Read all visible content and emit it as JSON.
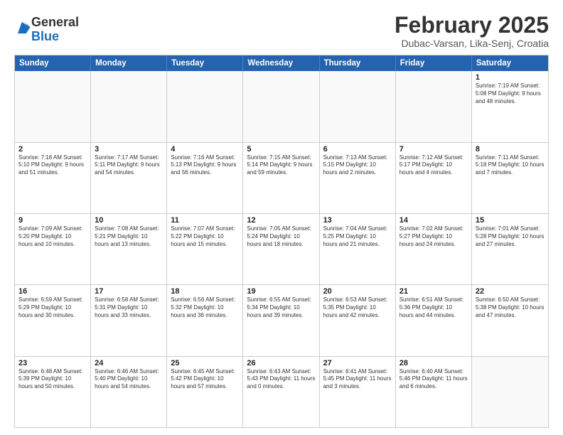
{
  "logo": {
    "general": "General",
    "blue": "Blue"
  },
  "title": "February 2025",
  "location": "Dubac-Varsan, Lika-Senj, Croatia",
  "header_days": [
    "Sunday",
    "Monday",
    "Tuesday",
    "Wednesday",
    "Thursday",
    "Friday",
    "Saturday"
  ],
  "rows": [
    [
      {
        "day": "",
        "text": ""
      },
      {
        "day": "",
        "text": ""
      },
      {
        "day": "",
        "text": ""
      },
      {
        "day": "",
        "text": ""
      },
      {
        "day": "",
        "text": ""
      },
      {
        "day": "",
        "text": ""
      },
      {
        "day": "1",
        "text": "Sunrise: 7:19 AM\nSunset: 5:08 PM\nDaylight: 9 hours\nand 48 minutes."
      }
    ],
    [
      {
        "day": "2",
        "text": "Sunrise: 7:18 AM\nSunset: 5:10 PM\nDaylight: 9 hours\nand 51 minutes."
      },
      {
        "day": "3",
        "text": "Sunrise: 7:17 AM\nSunset: 5:11 PM\nDaylight: 9 hours\nand 54 minutes."
      },
      {
        "day": "4",
        "text": "Sunrise: 7:16 AM\nSunset: 5:13 PM\nDaylight: 9 hours\nand 56 minutes."
      },
      {
        "day": "5",
        "text": "Sunrise: 7:15 AM\nSunset: 5:14 PM\nDaylight: 9 hours\nand 59 minutes."
      },
      {
        "day": "6",
        "text": "Sunrise: 7:13 AM\nSunset: 5:15 PM\nDaylight: 10 hours\nand 2 minutes."
      },
      {
        "day": "7",
        "text": "Sunrise: 7:12 AM\nSunset: 5:17 PM\nDaylight: 10 hours\nand 4 minutes."
      },
      {
        "day": "8",
        "text": "Sunrise: 7:11 AM\nSunset: 5:18 PM\nDaylight: 10 hours\nand 7 minutes."
      }
    ],
    [
      {
        "day": "9",
        "text": "Sunrise: 7:09 AM\nSunset: 5:20 PM\nDaylight: 10 hours\nand 10 minutes."
      },
      {
        "day": "10",
        "text": "Sunrise: 7:08 AM\nSunset: 5:21 PM\nDaylight: 10 hours\nand 13 minutes."
      },
      {
        "day": "11",
        "text": "Sunrise: 7:07 AM\nSunset: 5:22 PM\nDaylight: 10 hours\nand 15 minutes."
      },
      {
        "day": "12",
        "text": "Sunrise: 7:05 AM\nSunset: 5:24 PM\nDaylight: 10 hours\nand 18 minutes."
      },
      {
        "day": "13",
        "text": "Sunrise: 7:04 AM\nSunset: 5:25 PM\nDaylight: 10 hours\nand 21 minutes."
      },
      {
        "day": "14",
        "text": "Sunrise: 7:02 AM\nSunset: 5:27 PM\nDaylight: 10 hours\nand 24 minutes."
      },
      {
        "day": "15",
        "text": "Sunrise: 7:01 AM\nSunset: 5:28 PM\nDaylight: 10 hours\nand 27 minutes."
      }
    ],
    [
      {
        "day": "16",
        "text": "Sunrise: 6:59 AM\nSunset: 5:29 PM\nDaylight: 10 hours\nand 30 minutes."
      },
      {
        "day": "17",
        "text": "Sunrise: 6:58 AM\nSunset: 5:31 PM\nDaylight: 10 hours\nand 33 minutes."
      },
      {
        "day": "18",
        "text": "Sunrise: 6:56 AM\nSunset: 5:32 PM\nDaylight: 10 hours\nand 36 minutes."
      },
      {
        "day": "19",
        "text": "Sunrise: 6:55 AM\nSunset: 5:34 PM\nDaylight: 10 hours\nand 39 minutes."
      },
      {
        "day": "20",
        "text": "Sunrise: 6:53 AM\nSunset: 5:35 PM\nDaylight: 10 hours\nand 42 minutes."
      },
      {
        "day": "21",
        "text": "Sunrise: 6:51 AM\nSunset: 5:36 PM\nDaylight: 10 hours\nand 44 minutes."
      },
      {
        "day": "22",
        "text": "Sunrise: 6:50 AM\nSunset: 5:38 PM\nDaylight: 10 hours\nand 47 minutes."
      }
    ],
    [
      {
        "day": "23",
        "text": "Sunrise: 6:48 AM\nSunset: 5:39 PM\nDaylight: 10 hours\nand 50 minutes."
      },
      {
        "day": "24",
        "text": "Sunrise: 6:46 AM\nSunset: 5:40 PM\nDaylight: 10 hours\nand 54 minutes."
      },
      {
        "day": "25",
        "text": "Sunrise: 6:45 AM\nSunset: 5:42 PM\nDaylight: 10 hours\nand 57 minutes."
      },
      {
        "day": "26",
        "text": "Sunrise: 6:43 AM\nSunset: 5:43 PM\nDaylight: 11 hours\nand 0 minutes."
      },
      {
        "day": "27",
        "text": "Sunrise: 6:41 AM\nSunset: 5:45 PM\nDaylight: 11 hours\nand 3 minutes."
      },
      {
        "day": "28",
        "text": "Sunrise: 6:40 AM\nSunset: 5:46 PM\nDaylight: 11 hours\nand 6 minutes."
      },
      {
        "day": "",
        "text": ""
      }
    ]
  ]
}
